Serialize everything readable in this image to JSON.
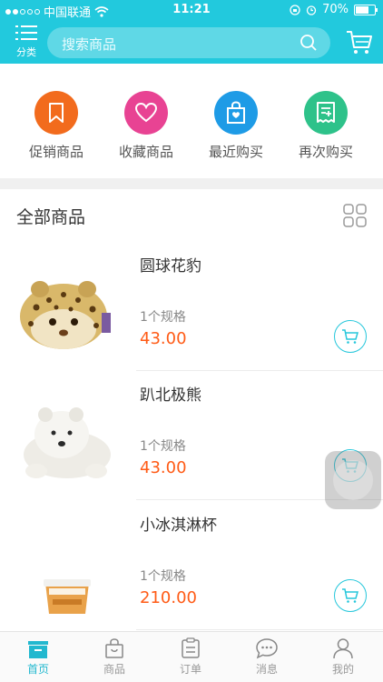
{
  "status_bar": {
    "carrier": "中国联通",
    "time": "11:21",
    "battery": "70%",
    "battery_level": 0.7
  },
  "header": {
    "category_label": "分类",
    "search_placeholder": "搜索商品"
  },
  "quick_actions": [
    {
      "label": "促销商品",
      "icon": "bookmark-icon",
      "color": "#f26b1d"
    },
    {
      "label": "收藏商品",
      "icon": "heart-icon",
      "color": "#e84393"
    },
    {
      "label": "最近购买",
      "icon": "shopping-bag-icon",
      "color": "#1e9be6"
    },
    {
      "label": "再次购买",
      "icon": "receipt-icon",
      "color": "#2ec28a"
    }
  ],
  "section": {
    "title": "全部商品"
  },
  "products": [
    {
      "name": "圆球花豹",
      "spec": "1个规格",
      "price": "43.00"
    },
    {
      "name": "趴北极熊",
      "spec": "1个规格",
      "price": "43.00"
    },
    {
      "name": "小冰淇淋杯",
      "spec": "1个规格",
      "price": "210.00"
    }
  ],
  "tabs": [
    {
      "label": "首页",
      "icon": "home-icon",
      "active": true
    },
    {
      "label": "商品",
      "icon": "bag-icon",
      "active": false
    },
    {
      "label": "订单",
      "icon": "clipboard-icon",
      "active": false
    },
    {
      "label": "消息",
      "icon": "chat-icon",
      "active": false
    },
    {
      "label": "我的",
      "icon": "user-icon",
      "active": false
    }
  ],
  "colors": {
    "accent": "#22c9dd",
    "price": "#ff5b16"
  }
}
